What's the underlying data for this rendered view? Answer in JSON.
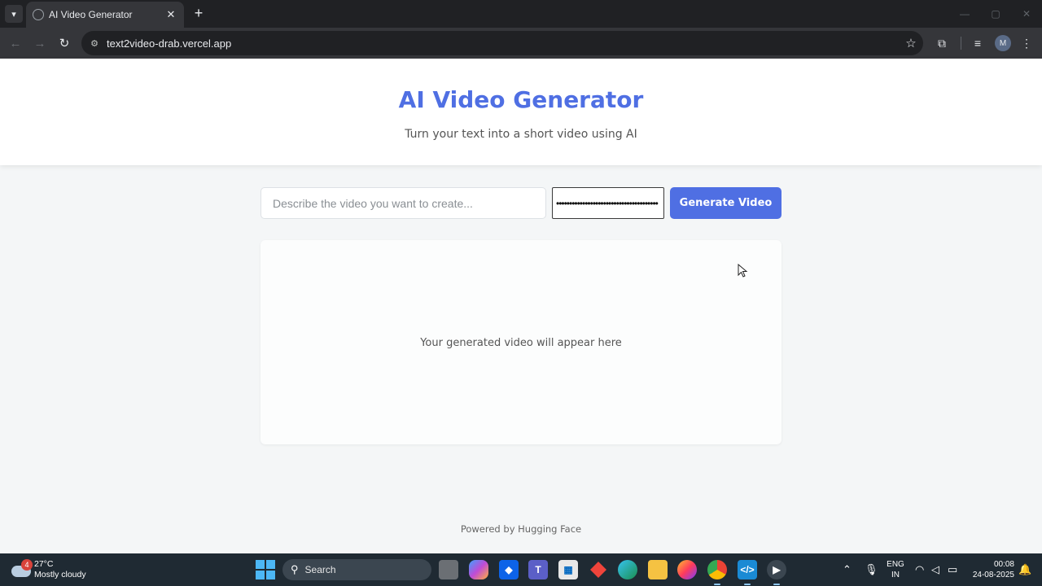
{
  "browser": {
    "tab_title": "AI Video Generator",
    "url": "text2video-drab.vercel.app",
    "profile_initial": "M"
  },
  "page": {
    "title": "AI Video Generator",
    "subtitle": "Turn your text into a short video using AI",
    "prompt_placeholder": "Describe the video you want to create...",
    "prompt_value": "",
    "api_key_value": "hf_xxxxxxxxxxxxxxxxxxxxxxxxxxxxxxxxxxxx",
    "generate_label": "Generate Video",
    "video_placeholder": "Your generated video will appear here",
    "footer": "Powered by Hugging Face"
  },
  "taskbar": {
    "weather_badge": "4",
    "weather_temp": "27°C",
    "weather_desc": "Mostly cloudy",
    "search_label": "Search",
    "lang_line1": "ENG",
    "lang_line2": "IN",
    "time": "00:08",
    "date": "24-08-2025"
  },
  "colors": {
    "accent": "#4f6fe3",
    "page_bg": "#f4f6f7",
    "browser_dark": "#202124",
    "taskbar": "#1f2a33"
  }
}
